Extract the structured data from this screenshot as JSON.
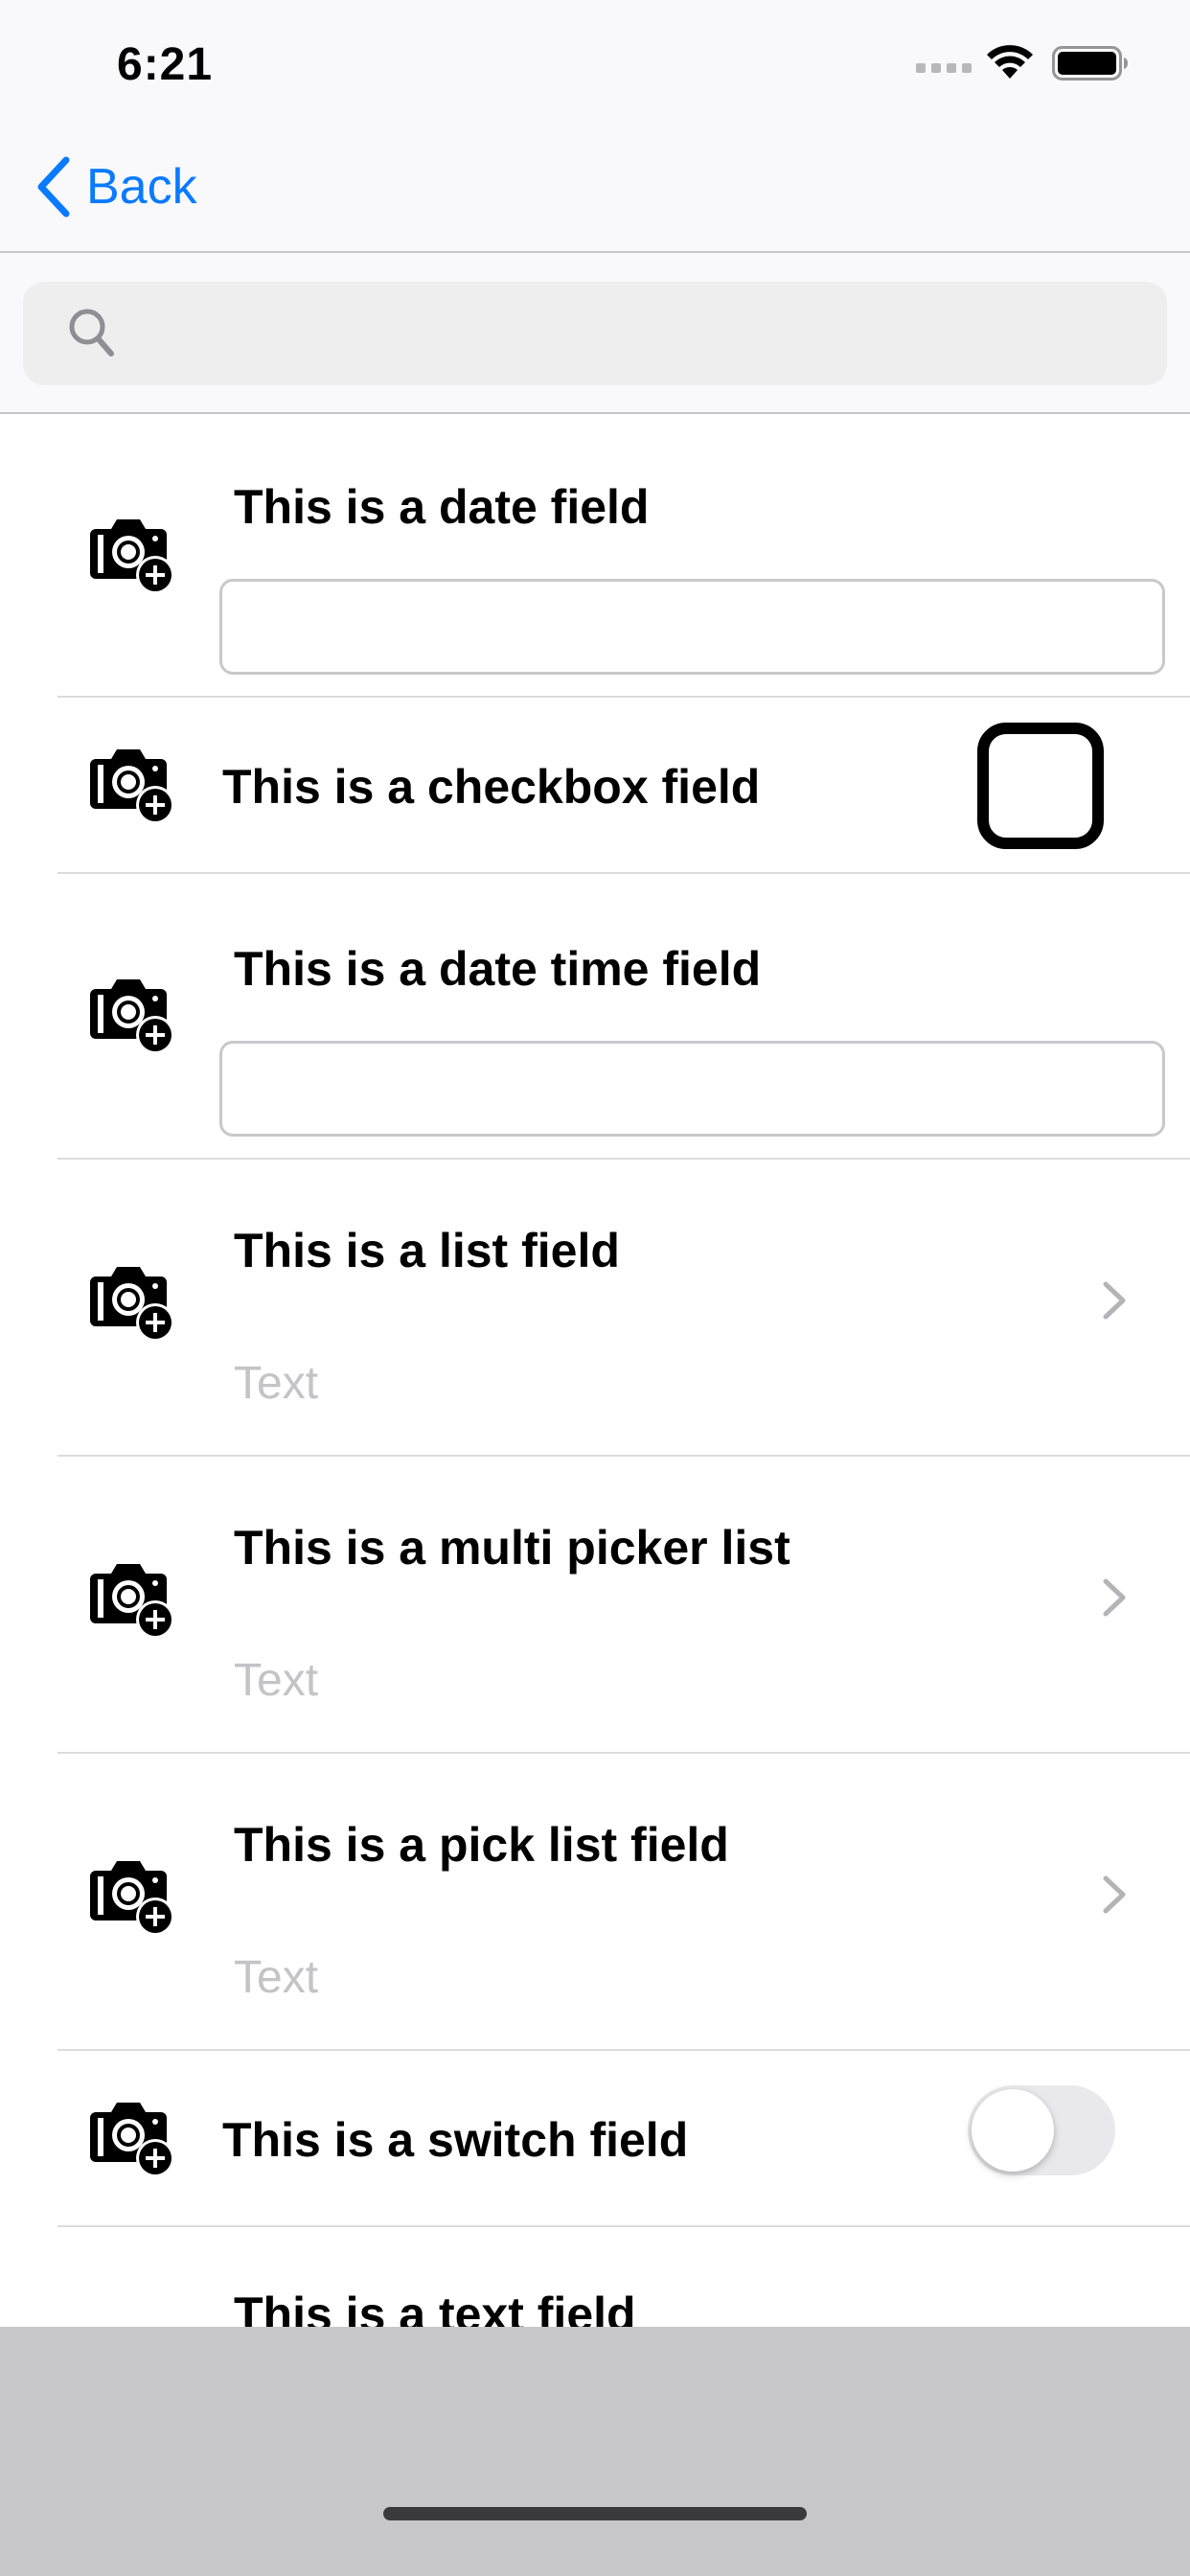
{
  "status_bar": {
    "time": "6:21"
  },
  "nav": {
    "back_label": "Back"
  },
  "search": {
    "value": "",
    "placeholder": ""
  },
  "fields": [
    {
      "type": "date",
      "label": "This is a date field",
      "value": ""
    },
    {
      "type": "checkbox",
      "label": "This is a checkbox field",
      "checked": false
    },
    {
      "type": "datetime",
      "label": "This is a date time field",
      "value": ""
    },
    {
      "type": "list",
      "label": "This is a list field",
      "value": "Text"
    },
    {
      "type": "multi-picker",
      "label": "This is a multi picker list",
      "value": "Text"
    },
    {
      "type": "picklist",
      "label": "This is a pick list field",
      "value": "Text"
    },
    {
      "type": "switch",
      "label": "This is a switch field",
      "on": false
    },
    {
      "type": "text",
      "label": "This is a text field"
    }
  ],
  "colors": {
    "accent": "#0a7aff",
    "placeholder": "#c4c4c7",
    "separator": "#dcdcdf"
  }
}
